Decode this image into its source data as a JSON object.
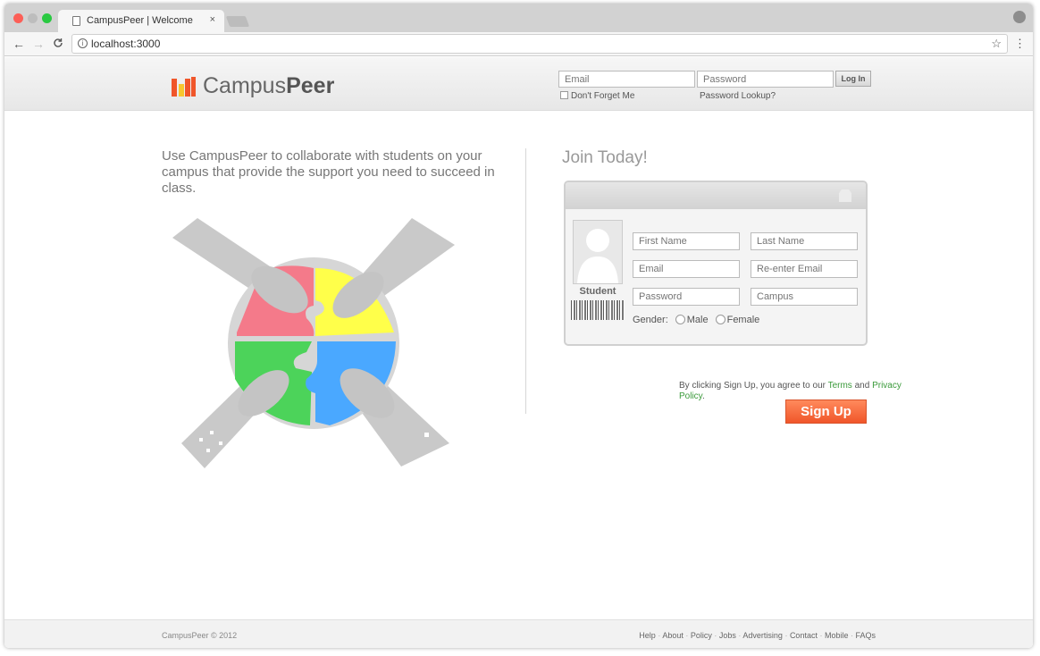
{
  "browser": {
    "tab_title": "CampusPeer | Welcome",
    "tab_close": "×",
    "url": "localhost:3000",
    "back_icon": "←",
    "forward_icon": "→",
    "reload_icon": "C",
    "info_icon": "i",
    "star_icon": "☆",
    "menu_icon": "⋮",
    "profile_icon": "●"
  },
  "header": {
    "logo_prefix": "Campus",
    "logo_suffix": "Peer",
    "email_placeholder": "Email",
    "password_placeholder": "Password",
    "login_label": "Log In",
    "remember_label": "Don't Forget Me",
    "lookup_label": "Password Lookup?"
  },
  "hero": {
    "tagline": "Use CampusPeer to collaborate with students on your campus that provide the support you need to succeed in class."
  },
  "signup": {
    "heading": "Join Today!",
    "student_label": "Student",
    "first_name": "First Name",
    "last_name": "Last Name",
    "email": "Email",
    "reenter_email": "Re-enter Email",
    "password": "Password",
    "campus": "Campus",
    "gender_label": "Gender:",
    "male": "Male",
    "female": "Female",
    "terms_prefix": "By clicking Sign Up, you agree to our ",
    "terms_link": "Terms",
    "terms_and": " and ",
    "privacy_link": "Privacy Policy",
    "terms_end": ".",
    "button": "Sign Up"
  },
  "footer": {
    "copyright": "CampusPeer © 2012",
    "links": [
      "Help",
      "About",
      "Policy",
      "Jobs",
      "Advertising",
      "Contact",
      "Mobile",
      "FAQs"
    ]
  },
  "colors": {
    "accent_orange": "#f0562a",
    "link_green": "#3a9a3a",
    "puzzle_pink": "#f47a8a",
    "puzzle_yellow": "#ffff4a",
    "puzzle_green": "#4cd35a",
    "puzzle_blue": "#4aa8ff"
  }
}
